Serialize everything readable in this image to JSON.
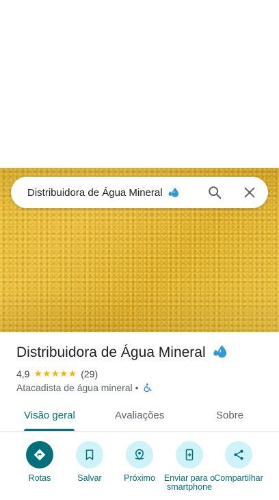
{
  "search": {
    "query": "Distribuidora de Água Mineral"
  },
  "place": {
    "title": "Distribuidora de Água Mineral",
    "rating": "4,9",
    "stars": "★★★★★",
    "review_count": "(29)",
    "category": "Atacadista de água mineral",
    "separator": "•"
  },
  "tabs": [
    {
      "label": "Visão geral",
      "active": true
    },
    {
      "label": "Avaliações",
      "active": false
    },
    {
      "label": "Sobre",
      "active": false
    }
  ],
  "actions": [
    {
      "label": "Rotas",
      "icon": "directions-icon"
    },
    {
      "label": "Salvar",
      "icon": "bookmark-icon"
    },
    {
      "label": "Próximo",
      "icon": "nearby-icon"
    },
    {
      "label": "Enviar para o smartphone",
      "icon": "send-to-phone-icon"
    },
    {
      "label": "Compartilhar",
      "icon": "share-icon"
    }
  ],
  "colors": {
    "accent": "#00707a",
    "action_bg": "#cdf2f8",
    "star": "#f4b400",
    "drops": "#2f9bd6"
  }
}
